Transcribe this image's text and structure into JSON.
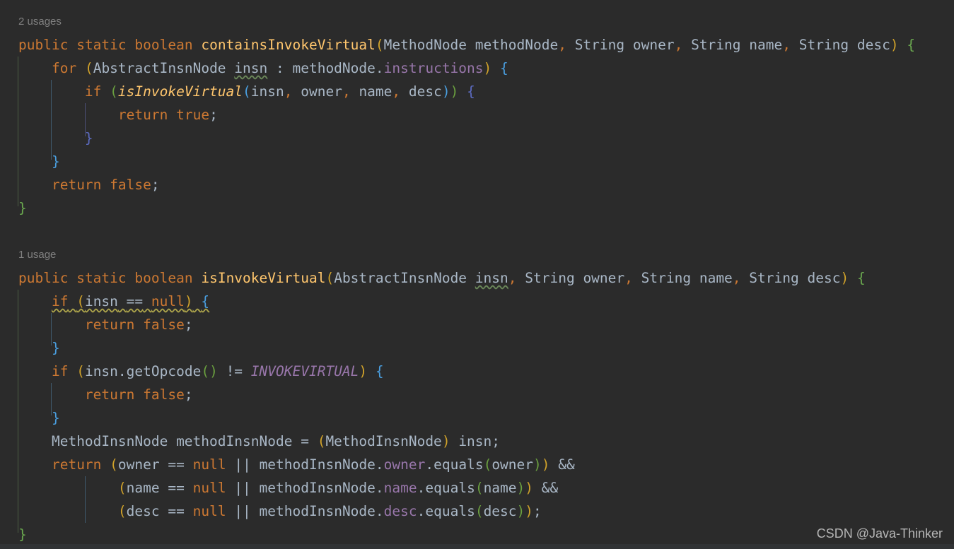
{
  "editor": {
    "theme": "darcula",
    "background": "#2b2b2b",
    "default_text_color": "#a9b7c6",
    "language": "java"
  },
  "watermark": {
    "text": "CSDN @Java-Thinker"
  },
  "inlay_hints": [
    {
      "id": "usages_1",
      "text": "2 usages"
    },
    {
      "id": "usages_2",
      "text": "1 usage"
    }
  ],
  "code": {
    "lines": [
      {
        "n": 1,
        "text": "2 usages",
        "kind": "hint"
      },
      {
        "n": 2,
        "text": "public static boolean containsInvokeVirtual(MethodNode methodNode, String owner, String name, String desc) {"
      },
      {
        "n": 3,
        "text": "    for (AbstractInsnNode insn : methodNode.instructions) {"
      },
      {
        "n": 4,
        "text": "        if (isInvokeVirtual(insn, owner, name, desc)) {"
      },
      {
        "n": 5,
        "text": "            return true;"
      },
      {
        "n": 6,
        "text": "        }"
      },
      {
        "n": 7,
        "text": "    }"
      },
      {
        "n": 8,
        "text": "    return false;"
      },
      {
        "n": 9,
        "text": "}"
      },
      {
        "n": 10,
        "text": ""
      },
      {
        "n": 11,
        "text": "1 usage",
        "kind": "hint"
      },
      {
        "n": 12,
        "text": "public static boolean isInvokeVirtual(AbstractInsnNode insn, String owner, String name, String desc) {"
      },
      {
        "n": 13,
        "text": "    if (insn == null) {"
      },
      {
        "n": 14,
        "text": "        return false;"
      },
      {
        "n": 15,
        "text": "    }"
      },
      {
        "n": 16,
        "text": "    if (insn.getOpcode() != INVOKEVIRTUAL) {"
      },
      {
        "n": 17,
        "text": "        return false;"
      },
      {
        "n": 18,
        "text": "    }"
      },
      {
        "n": 19,
        "text": "    MethodInsnNode methodInsnNode = (MethodInsnNode) insn;"
      },
      {
        "n": 20,
        "text": "    return (owner == null || methodInsnNode.owner.equals(owner)) &&"
      },
      {
        "n": 21,
        "text": "            (name == null || methodInsnNode.name.equals(name)) &&"
      },
      {
        "n": 22,
        "text": "            (desc == null || methodInsnNode.desc.equals(desc));"
      },
      {
        "n": 23,
        "text": "}"
      }
    ],
    "tokens": {
      "keywords": [
        "public",
        "static",
        "boolean",
        "for",
        "if",
        "return",
        "true",
        "false",
        "null"
      ],
      "methods_declared": [
        "containsInvokeVirtual",
        "isInvokeVirtual"
      ],
      "methods_called": [
        "isInvokeVirtual",
        "getOpcode",
        "equals"
      ],
      "types": [
        "MethodNode",
        "String",
        "AbstractInsnNode",
        "MethodInsnNode"
      ],
      "fields": [
        "instructions",
        "owner",
        "name",
        "desc"
      ],
      "constants": [
        "INVOKEVIRTUAL"
      ],
      "variables": [
        "methodNode",
        "insn",
        "owner",
        "name",
        "desc",
        "methodInsnNode"
      ]
    },
    "colors": {
      "keyword": "#cc7832",
      "method_declaration": "#ffc66d",
      "field": "#9876aa",
      "constant": "#9876aa",
      "identifier": "#a9b7c6",
      "hint": "#808080",
      "bracket_yellow": "#d0a22a",
      "bracket_green": "#6a9f3f",
      "bracket_blue": "#4a9fe0",
      "bracket_indigo": "#5c6bc0",
      "warning_squiggle": "#a9a14a",
      "info_squiggle": "#6a8759"
    }
  }
}
